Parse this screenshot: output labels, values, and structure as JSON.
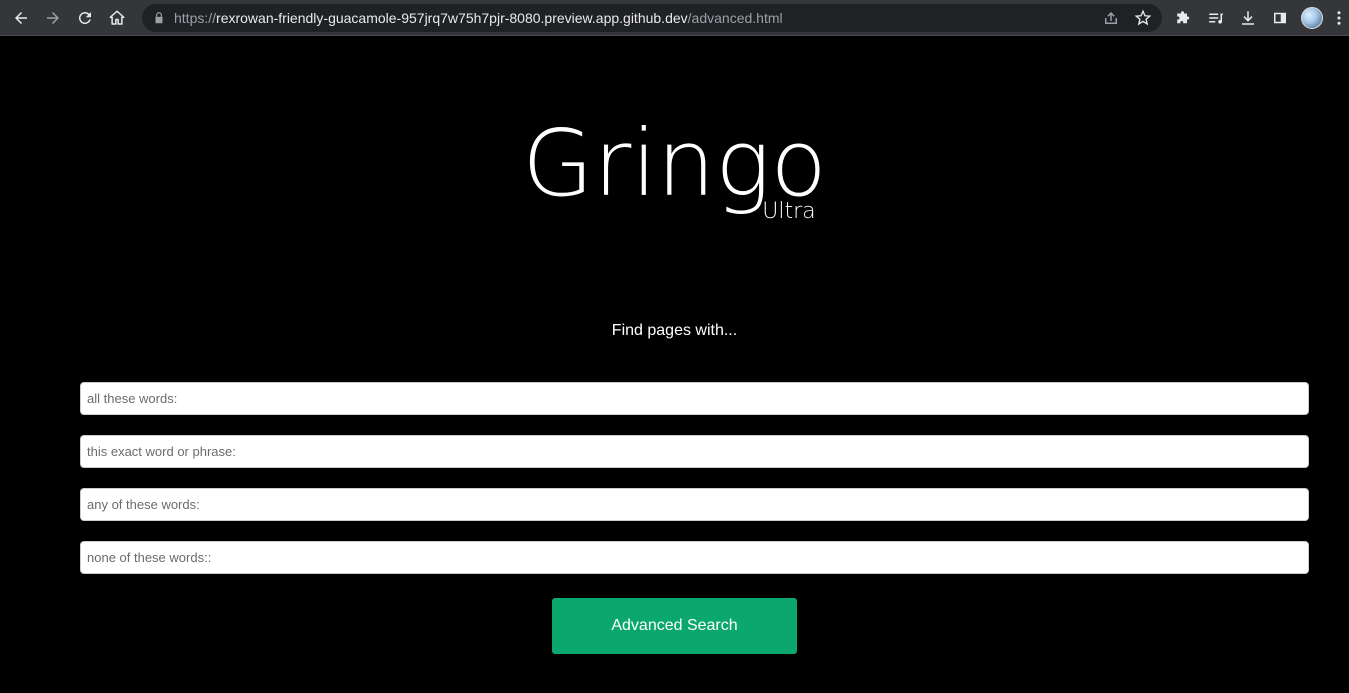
{
  "browser": {
    "url_scheme": "https://",
    "url_host": "rexrowan-friendly-guacamole-957jrq7w75h7pjr-8080.preview.app.github.dev",
    "url_path": "/advanced.html",
    "icons": [
      "back-icon",
      "forward-icon",
      "reload-icon",
      "home-icon",
      "lock-icon",
      "share-icon",
      "star-icon",
      "extensions-icon",
      "reading-list-icon",
      "download-icon",
      "side-panel-icon",
      "avatar",
      "menu-icon"
    ]
  },
  "logo": {
    "title": "Gringo",
    "subtitle": "Ultra"
  },
  "tagline": "Find pages with...",
  "fields": {
    "all_words": "all these words:",
    "exact_phrase": "this exact word or phrase:",
    "any_words": "any of these words:",
    "none_words": "none of these words::"
  },
  "button": {
    "label": "Advanced Search"
  },
  "colors": {
    "background": "#000000",
    "button": "#0aa86f",
    "chrome": "#35363a"
  }
}
